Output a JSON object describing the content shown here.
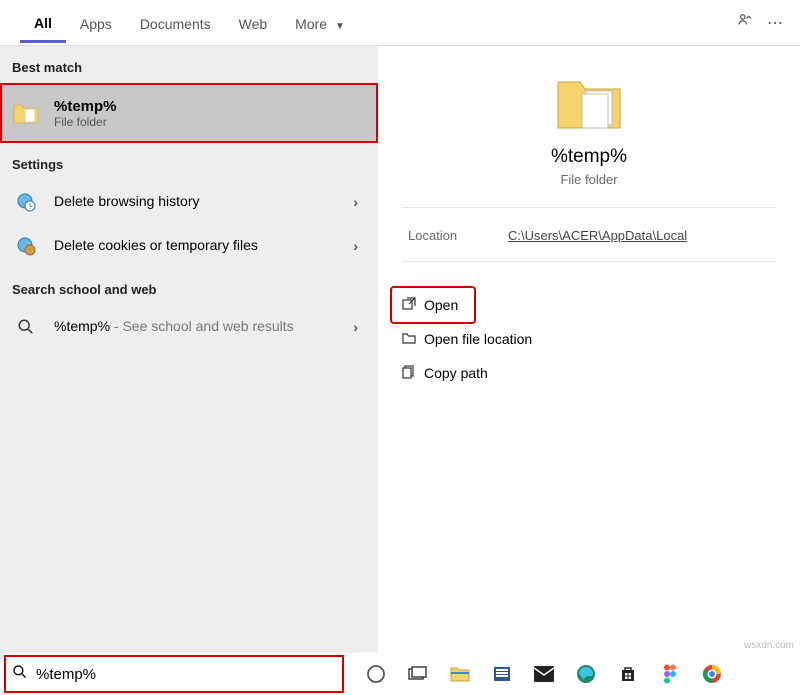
{
  "tabs": {
    "items": [
      {
        "label": "All",
        "active": true
      },
      {
        "label": "Apps",
        "active": false
      },
      {
        "label": "Documents",
        "active": false
      },
      {
        "label": "Web",
        "active": false
      },
      {
        "label": "More",
        "active": false,
        "dropdown": true
      }
    ]
  },
  "sections": {
    "best_match": "Best match",
    "settings": "Settings",
    "web": "Search school and web"
  },
  "best_match": {
    "title": "%temp%",
    "sub": "File folder"
  },
  "settings_items": [
    {
      "label": "Delete browsing history",
      "icon": "globe-clock"
    },
    {
      "label": "Delete cookies or temporary files",
      "icon": "globe-cookie"
    }
  ],
  "web_items": [
    {
      "label": "%temp%",
      "hint": " - See school and web results",
      "icon": "search"
    }
  ],
  "preview": {
    "title": "%temp%",
    "sub": "File folder",
    "location_label": "Location",
    "location_value": "C:\\Users\\ACER\\AppData\\Local"
  },
  "actions": {
    "open": "Open",
    "open_loc": "Open file location",
    "copy_path": "Copy path"
  },
  "search": {
    "value": "%temp%"
  },
  "watermark": "wsxdn.com"
}
